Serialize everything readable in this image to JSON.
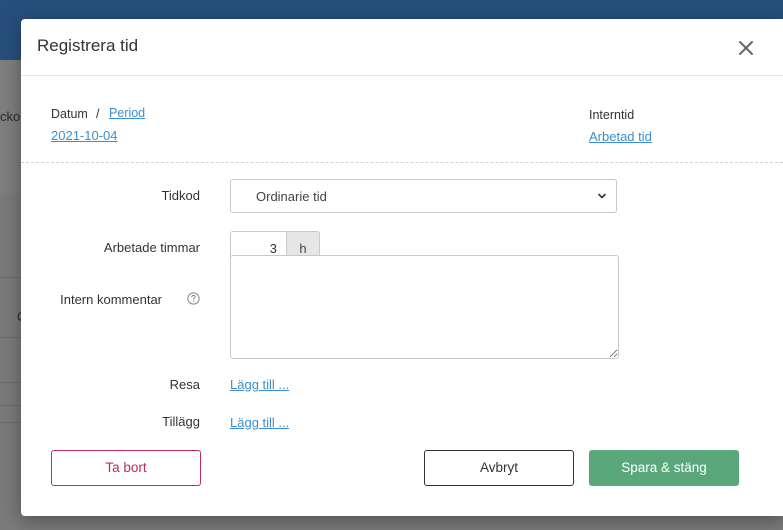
{
  "background": {
    "partial_text_1": "ckor",
    "partial_text_2": "C"
  },
  "modal": {
    "title": "Registrera tid",
    "date": {
      "label": "Datum",
      "separator": "/",
      "period_link": "Period",
      "value": "2021-10-04"
    },
    "internal": {
      "label": "Interntid",
      "value": "Arbetad tid"
    },
    "form": {
      "tidkod": {
        "label": "Tidkod",
        "value": "Ordinarie tid"
      },
      "hours": {
        "label": "Arbetade timmar",
        "value": "3",
        "unit": "h"
      },
      "comment": {
        "label": "Intern kommentar",
        "value": ""
      },
      "travel": {
        "label": "Resa",
        "link": "Lägg till ..."
      },
      "addition": {
        "label": "Tillägg",
        "link": "Lägg till ..."
      }
    },
    "buttons": {
      "delete": "Ta bort",
      "cancel": "Avbryt",
      "save": "Spara & stäng"
    }
  },
  "colors": {
    "accent_link": "#3b8fd1",
    "delete": "#c12b59",
    "save": "#5aa77c",
    "topbar": "#274f7c"
  },
  "icons": {
    "close": "close-icon",
    "dropdown": "chevron-down-icon",
    "help": "question-circle-icon"
  }
}
